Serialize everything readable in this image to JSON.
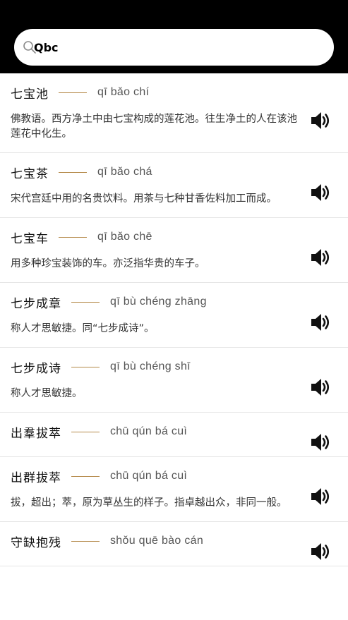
{
  "search": {
    "value": "Qbc",
    "placeholder": ""
  },
  "entries": [
    {
      "word": "七宝池",
      "pinyin": "qī bǎo chí",
      "definition": "佛教语。西方净土中由七宝构成的莲花池。往生净土的人在该池莲花中化生。"
    },
    {
      "word": "七宝茶",
      "pinyin": "qī bǎo chá",
      "definition": "宋代宫廷中用的名贵饮料。用茶与七种甘香佐料加工而成。"
    },
    {
      "word": "七宝车",
      "pinyin": "qī bǎo chē",
      "definition": "用多种珍宝装饰的车。亦泛指华贵的车子。"
    },
    {
      "word": "七步成章",
      "pinyin": "qī bù chéng zhāng",
      "definition": "称人才思敏捷。同“七步成诗”。"
    },
    {
      "word": "七步成诗",
      "pinyin": "qī bù chéng shī",
      "definition": "称人才思敏捷。"
    },
    {
      "word": "出羣拔萃",
      "pinyin": "chū qún bá cuì",
      "definition": ""
    },
    {
      "word": "出群拔萃",
      "pinyin": "chū qún bá cuì",
      "definition": "拔，超出；萃，原为草丛生的样子。指卓越出众，非同一般。"
    },
    {
      "word": "守缺抱残",
      "pinyin": "shǒu quē bào cán",
      "definition": ""
    }
  ],
  "icons": {
    "search": "search-icon",
    "speaker": "speaker-icon"
  },
  "colors": {
    "header": "#000000",
    "dash": "#b58a4a"
  }
}
